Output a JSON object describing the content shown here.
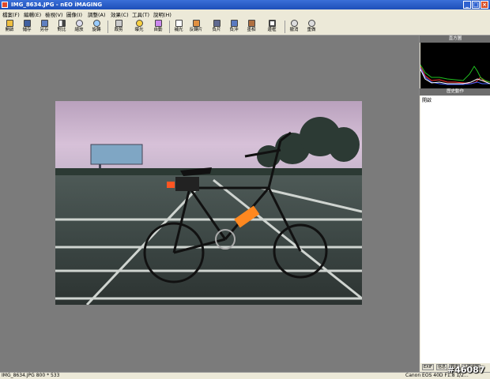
{
  "window": {
    "title": "IMG_8634.JPG - nEO iMAGING",
    "min_glyph": "_",
    "max_glyph": "□",
    "close_glyph": "×"
  },
  "menu": [
    "檔案(F)",
    "編輯(E)",
    "檢視(V)",
    "圖像(I)",
    "調整(A)",
    "效果(C)",
    "工具(T)",
    "說明(H)"
  ],
  "toolbar": [
    "開啟",
    "儲存",
    "另存",
    "對比",
    "縮放",
    "旋轉",
    "裁剪",
    "曝光",
    "自動",
    "補光",
    "反轉片",
    "負片",
    "負沖",
    "墨相",
    "邊框",
    "撤消",
    "重做"
  ],
  "panel": {
    "histogram_title": "直方圖",
    "history_title": "歷史動作",
    "history_items": [
      "開啟"
    ],
    "tabs": [
      "EXIF",
      "信息",
      "歷史",
      "人臉追蹤"
    ]
  },
  "status": {
    "file": "IMG_8634.JPG  800 * 533",
    "camera": "Canon EOS 40D  F1.8 1/2..."
  },
  "watermark": "#46087",
  "colors": {
    "title_bar": "#1d4fb8",
    "canvas_bg": "#7b7b7b",
    "histogram_red": "#ff3030",
    "histogram_green": "#20c020",
    "histogram_blue": "#4060ff"
  }
}
